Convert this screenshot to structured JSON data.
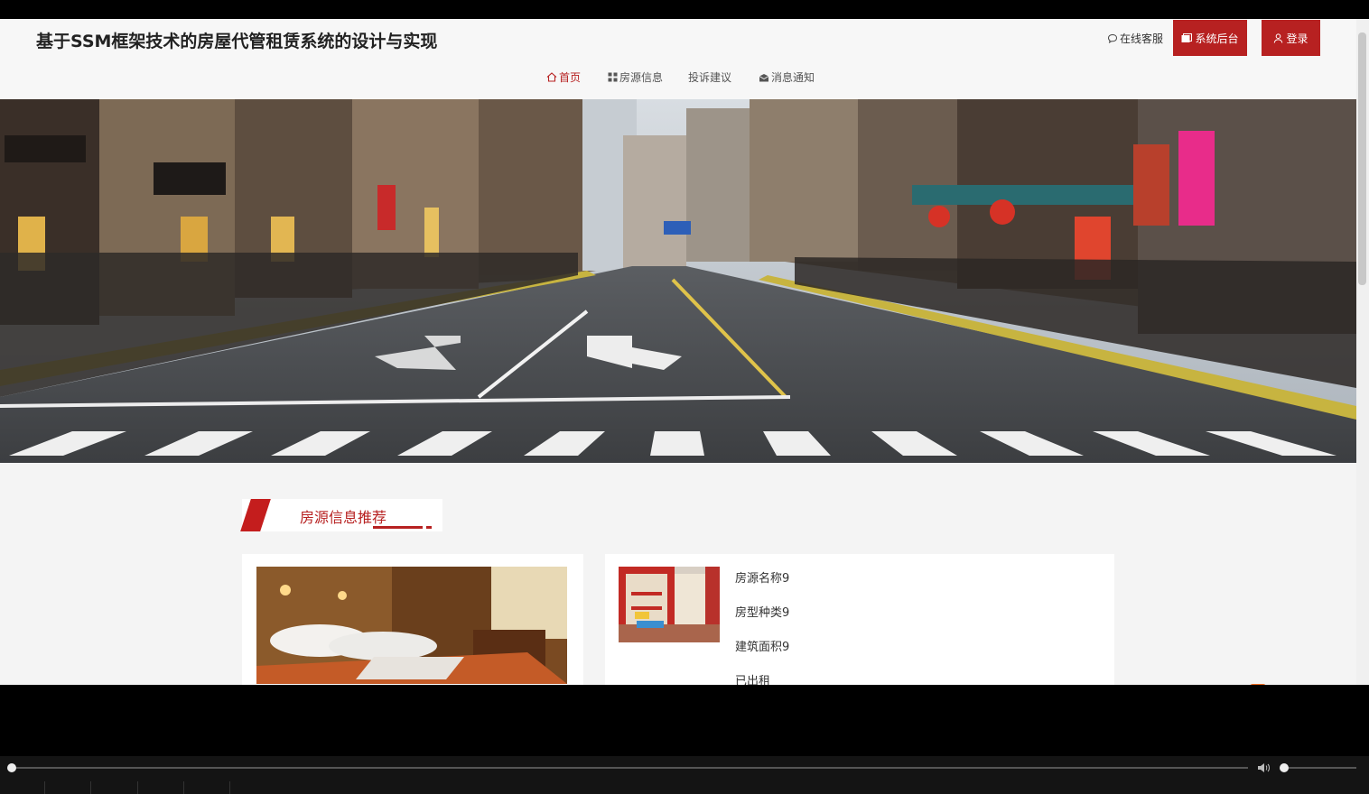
{
  "header": {
    "site_title": "基于SSM框架技术的房屋代管租赁系统的设计与实现",
    "online_service": "在线客服",
    "admin_button": "系统后台",
    "login_button": "登录"
  },
  "nav": {
    "items": [
      {
        "label": "首页",
        "icon": "home-icon",
        "active": true
      },
      {
        "label": "房源信息",
        "icon": "grid-icon",
        "active": false
      },
      {
        "label": "投诉建议",
        "icon": "",
        "active": false
      },
      {
        "label": "消息通知",
        "icon": "envelope-icon",
        "active": false
      }
    ]
  },
  "banner": {
    "image": "shanghai-street-photo"
  },
  "section": {
    "title": "房源信息推荐"
  },
  "featured": {
    "name": "房源名称9",
    "type": "房型种类9",
    "area": "建筑面积9",
    "status": "已出租"
  },
  "player": {
    "progress": 0.0,
    "volume": 0.05
  },
  "colors": {
    "accent": "#b72121",
    "page_bg": "#f4f4f4",
    "header_bg": "#f7f7f7"
  }
}
